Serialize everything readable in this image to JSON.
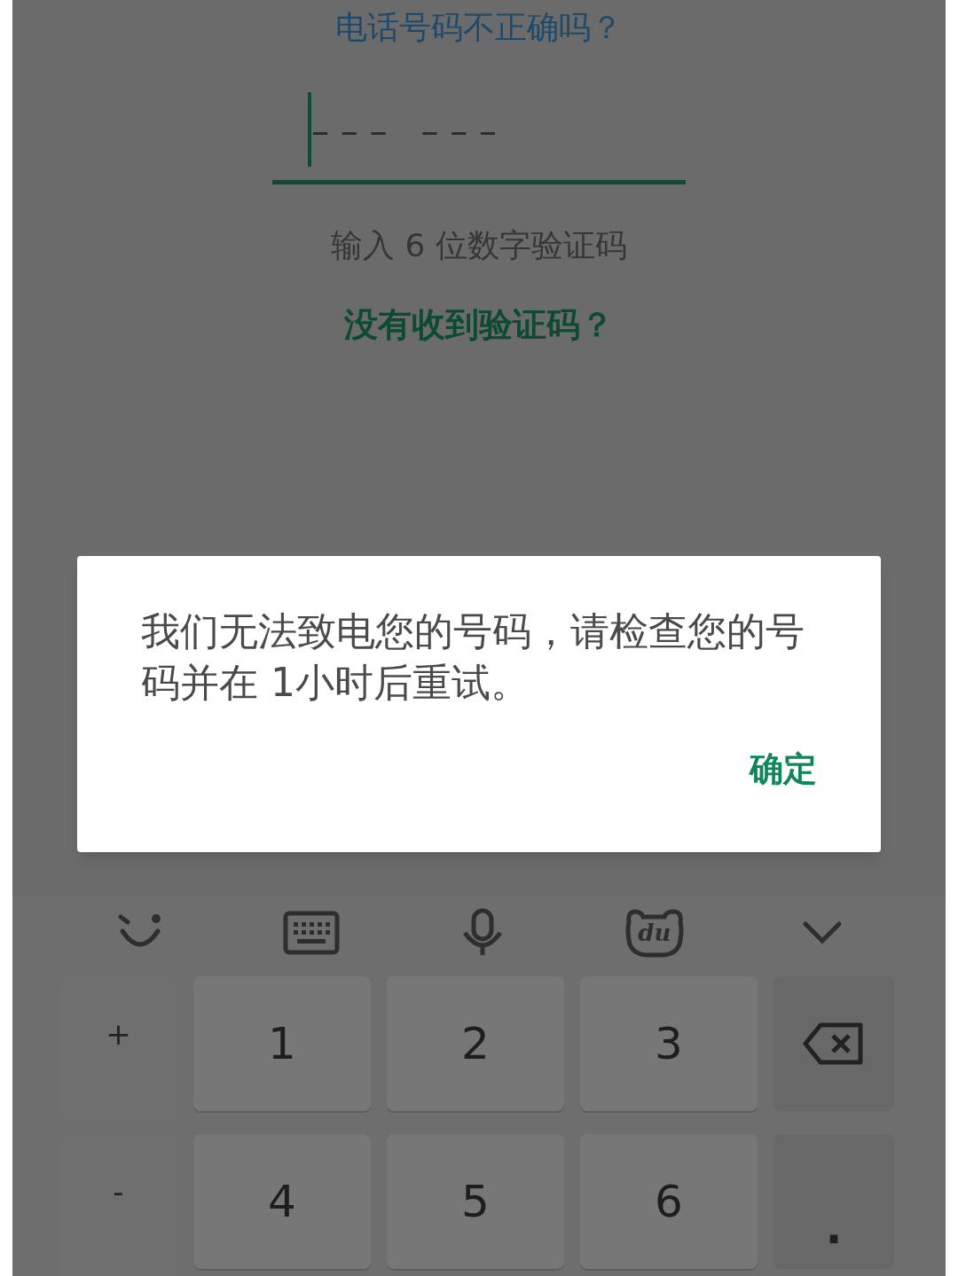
{
  "header": {
    "wrong_number_link": "电话号码不正确吗？"
  },
  "code_field": {
    "placeholder": "– – –   – – –",
    "focused": true
  },
  "hint": "输入 6 位数字验证码",
  "resend_link": "没有收到验证码？",
  "dialog": {
    "message": "我们无法致电您的号码，请检查您的号码并在 1小时后重试。",
    "button": "确定"
  },
  "keyboard_toolbar": [
    {
      "kind": "emoji"
    },
    {
      "kind": "keyboard"
    },
    {
      "kind": "mic"
    },
    {
      "kind": "bear",
      "text": "du"
    },
    {
      "kind": "collapse"
    }
  ],
  "keys": [
    {
      "kind": "side",
      "label": "+"
    },
    {
      "kind": "digit",
      "label": "1"
    },
    {
      "kind": "digit",
      "label": "2"
    },
    {
      "kind": "digit",
      "label": "3"
    },
    {
      "kind": "backspace"
    },
    {
      "kind": "side",
      "label": "-"
    },
    {
      "kind": "digit",
      "label": "4"
    },
    {
      "kind": "digit",
      "label": "5"
    },
    {
      "kind": "digit",
      "label": "6"
    },
    {
      "kind": "side_right",
      "label": "."
    }
  ]
}
